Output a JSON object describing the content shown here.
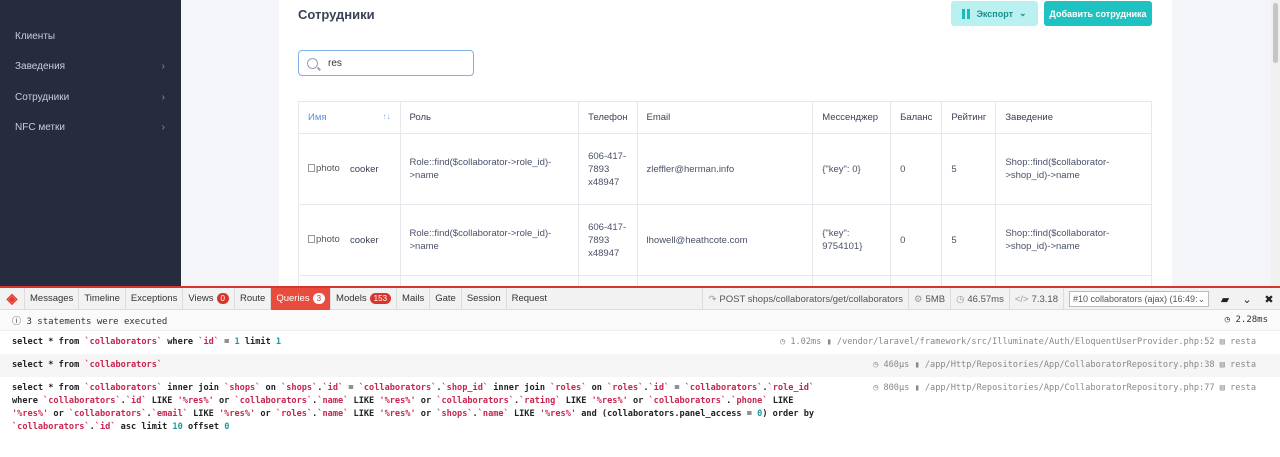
{
  "sidebar": {
    "items": [
      {
        "label": "Клиенты",
        "has_submenu": false
      },
      {
        "label": "Заведения",
        "has_submenu": true
      },
      {
        "label": "Сотрудники",
        "has_submenu": true
      },
      {
        "label": "NFC метки",
        "has_submenu": true
      }
    ]
  },
  "page": {
    "title": "Сотрудники",
    "export_label": "Экспорт",
    "add_label": "Добавить сотрудника"
  },
  "search": {
    "value": "res",
    "placeholder": ""
  },
  "table": {
    "columns": [
      "Имя",
      "Роль",
      "Телефон",
      "Email",
      "Мессенджер",
      "Баланс",
      "Рейтинг",
      "Заведение"
    ],
    "rows": [
      {
        "photo_alt": "photo",
        "name": "cooker",
        "role": "Role::find($collaborator->role_id)->name",
        "phone": "606-417-7893 x48947",
        "email": "zleffler@herman.info",
        "messenger": "{\"key\": 0}",
        "balance": "0",
        "rating": "5",
        "shop": "Shop::find($collaborator->shop_id)->name"
      },
      {
        "photo_alt": "photo",
        "name": "cooker",
        "role": "Role::find($collaborator->role_id)->name",
        "phone": "606-417-7893 x48947",
        "email": "lhowell@heathcote.com",
        "messenger": "{\"key\": 9754101}",
        "balance": "0",
        "rating": "5",
        "shop": "Shop::find($collaborator->shop_id)->name"
      }
    ]
  },
  "debugbar": {
    "tabs": [
      {
        "label": "Messages"
      },
      {
        "label": "Timeline"
      },
      {
        "label": "Exceptions"
      },
      {
        "label": "Views",
        "badge": "0"
      },
      {
        "label": "Route"
      },
      {
        "label": "Queries",
        "badge": "3",
        "active": true
      },
      {
        "label": "Models",
        "badge": "153"
      },
      {
        "label": "Mails"
      },
      {
        "label": "Gate"
      },
      {
        "label": "Session"
      },
      {
        "label": "Request"
      }
    ],
    "request": "POST shops/collaborators/get/collaborators",
    "memory": "5MB",
    "time": "46.57ms",
    "php_version": "7.3.18",
    "dataset": "#10 collaborators (ajax) (16:49:",
    "summary": "3 statements were executed",
    "total_time": "2.28ms",
    "queries": [
      {
        "time": "1.02ms",
        "source": "/vendor/laravel/framework/src/Illuminate/Auth/EloquentUserProvider.php:52",
        "conn": "resta"
      },
      {
        "time": "460μs",
        "source": "/app/Http/Repositories/App/CollaboratorRepository.php:38",
        "conn": "resta"
      },
      {
        "time": "800μs",
        "source": "/app/Http/Repositories/App/CollaboratorRepository.php:77",
        "conn": "resta"
      }
    ]
  },
  "colors": {
    "sidebar_bg": "#262b3e",
    "accent": "#1ec2c0",
    "debug_red": "#e74c3c"
  }
}
